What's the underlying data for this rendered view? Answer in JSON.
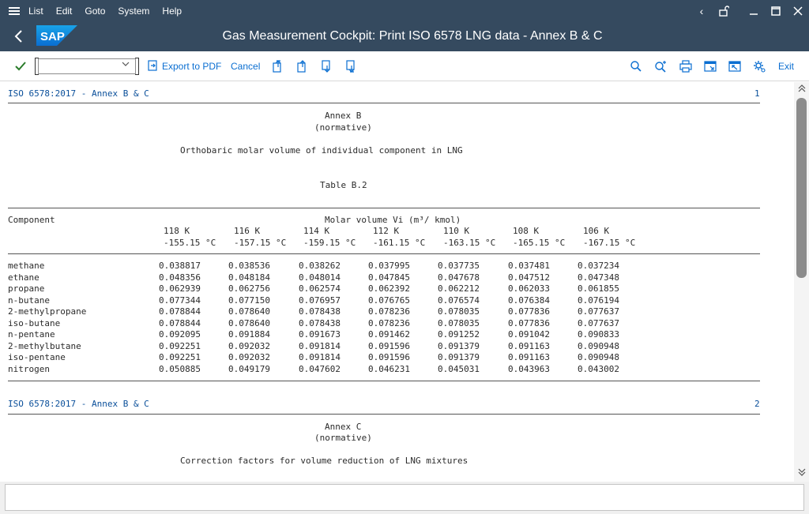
{
  "menu": [
    "List",
    "Edit",
    "Goto",
    "System",
    "Help"
  ],
  "title": "Gas Measurement Cockpit: Print ISO 6578 LNG data - Annex B & C",
  "toolbar": {
    "export_label": "Export to PDF",
    "cancel_label": "Cancel",
    "exit_label": "Exit",
    "command_value": ""
  },
  "report": {
    "page1": {
      "header": "ISO 6578:2017 - Annex B & C",
      "page_number": "1",
      "annex": "Annex B",
      "normative": "(normative)",
      "subtitle": "Orthobaric molar volume of individual component in LNG",
      "table_title": "Table B.2",
      "component_label": "Component",
      "molar_label": "Molar volume Vi (m³/ kmol)",
      "kelvin": [
        "118 K",
        "116 K",
        "114 K",
        "112 K",
        "110 K",
        "108 K",
        "106 K"
      ],
      "celsius": [
        "-155.15 °C",
        "-157.15 °C",
        "-159.15 °C",
        "-161.15 °C",
        "-163.15 °C",
        "-165.15 °C",
        "-167.15 °C"
      ],
      "rows": [
        {
          "name": "methane",
          "values": [
            "0.038817",
            "0.038536",
            "0.038262",
            "0.037995",
            "0.037735",
            "0.037481",
            "0.037234"
          ]
        },
        {
          "name": "ethane",
          "values": [
            "0.048356",
            "0.048184",
            "0.048014",
            "0.047845",
            "0.047678",
            "0.047512",
            "0.047348"
          ]
        },
        {
          "name": "propane",
          "values": [
            "0.062939",
            "0.062756",
            "0.062574",
            "0.062392",
            "0.062212",
            "0.062033",
            "0.061855"
          ]
        },
        {
          "name": "n-butane",
          "values": [
            "0.077344",
            "0.077150",
            "0.076957",
            "0.076765",
            "0.076574",
            "0.076384",
            "0.076194"
          ]
        },
        {
          "name": "2-methylpropane",
          "values": [
            "0.078844",
            "0.078640",
            "0.078438",
            "0.078236",
            "0.078035",
            "0.077836",
            "0.077637"
          ]
        },
        {
          "name": "iso-butane",
          "values": [
            "0.078844",
            "0.078640",
            "0.078438",
            "0.078236",
            "0.078035",
            "0.077836",
            "0.077637"
          ]
        },
        {
          "name": "n-pentane",
          "values": [
            "0.092095",
            "0.091884",
            "0.091673",
            "0.091462",
            "0.091252",
            "0.091042",
            "0.090833"
          ]
        },
        {
          "name": "2-methylbutane",
          "values": [
            "0.092251",
            "0.092032",
            "0.091814",
            "0.091596",
            "0.091379",
            "0.091163",
            "0.090948"
          ]
        },
        {
          "name": "iso-pentane",
          "values": [
            "0.092251",
            "0.092032",
            "0.091814",
            "0.091596",
            "0.091379",
            "0.091163",
            "0.090948"
          ]
        },
        {
          "name": "nitrogen",
          "values": [
            "0.050885",
            "0.049179",
            "0.047602",
            "0.046231",
            "0.045031",
            "0.043963",
            "0.043002"
          ]
        }
      ]
    },
    "page2": {
      "header": "ISO 6578:2017 - Annex B & C",
      "page_number": "2",
      "annex": "Annex C",
      "normative": "(normative)",
      "subtitle": "Correction factors for volume reduction of LNG mixtures"
    }
  },
  "status": {
    "message": ""
  },
  "colors": {
    "shell": "#354a5f",
    "accent": "#0a6ed1",
    "confirm": "#2b7c2b"
  }
}
